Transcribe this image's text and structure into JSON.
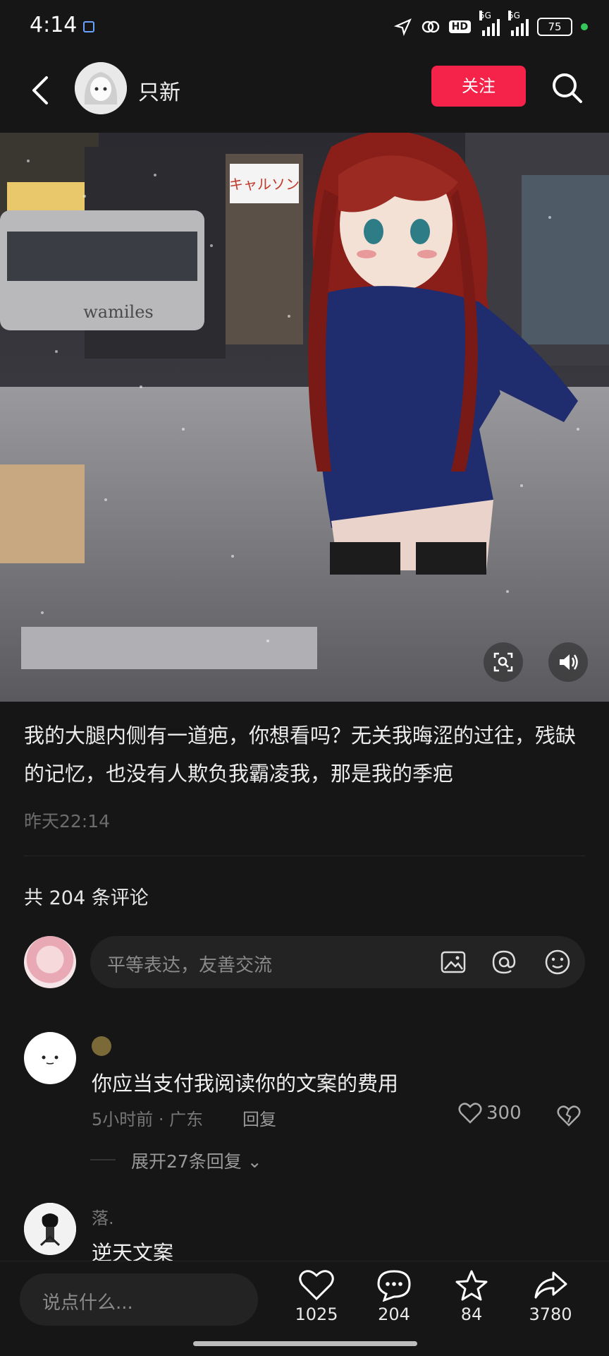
{
  "status": {
    "time": "4:14",
    "network": "5G",
    "hd": "HD",
    "battery": "75"
  },
  "header": {
    "author": "只新",
    "follow": "关注"
  },
  "post": {
    "caption": "我的大腿内侧有一道疤，你想看吗？无关我晦涩的过往，残缺的记忆，也没有人欺负我霸凌我，那是我的季疤",
    "time": "昨天22:14",
    "image_text": {
      "sign": "キャルソン",
      "tram": "wamiles"
    }
  },
  "comments": {
    "count_label": "共 204 条评论",
    "input_placeholder": "平等表达，友善交流",
    "items": [
      {
        "name": "",
        "text": "你应当支付我阅读你的文案的费用",
        "meta": "5小时前 · 广东",
        "reply": "回复",
        "likes": "300",
        "expand": "展开27条回复"
      },
      {
        "name": "落.",
        "text": "逆天文案"
      }
    ]
  },
  "bottom": {
    "placeholder": "说点什么...",
    "likes": "1025",
    "comments": "204",
    "favorites": "84",
    "shares": "3780"
  },
  "colors": {
    "accent": "#f5224a",
    "bg": "#161616"
  }
}
